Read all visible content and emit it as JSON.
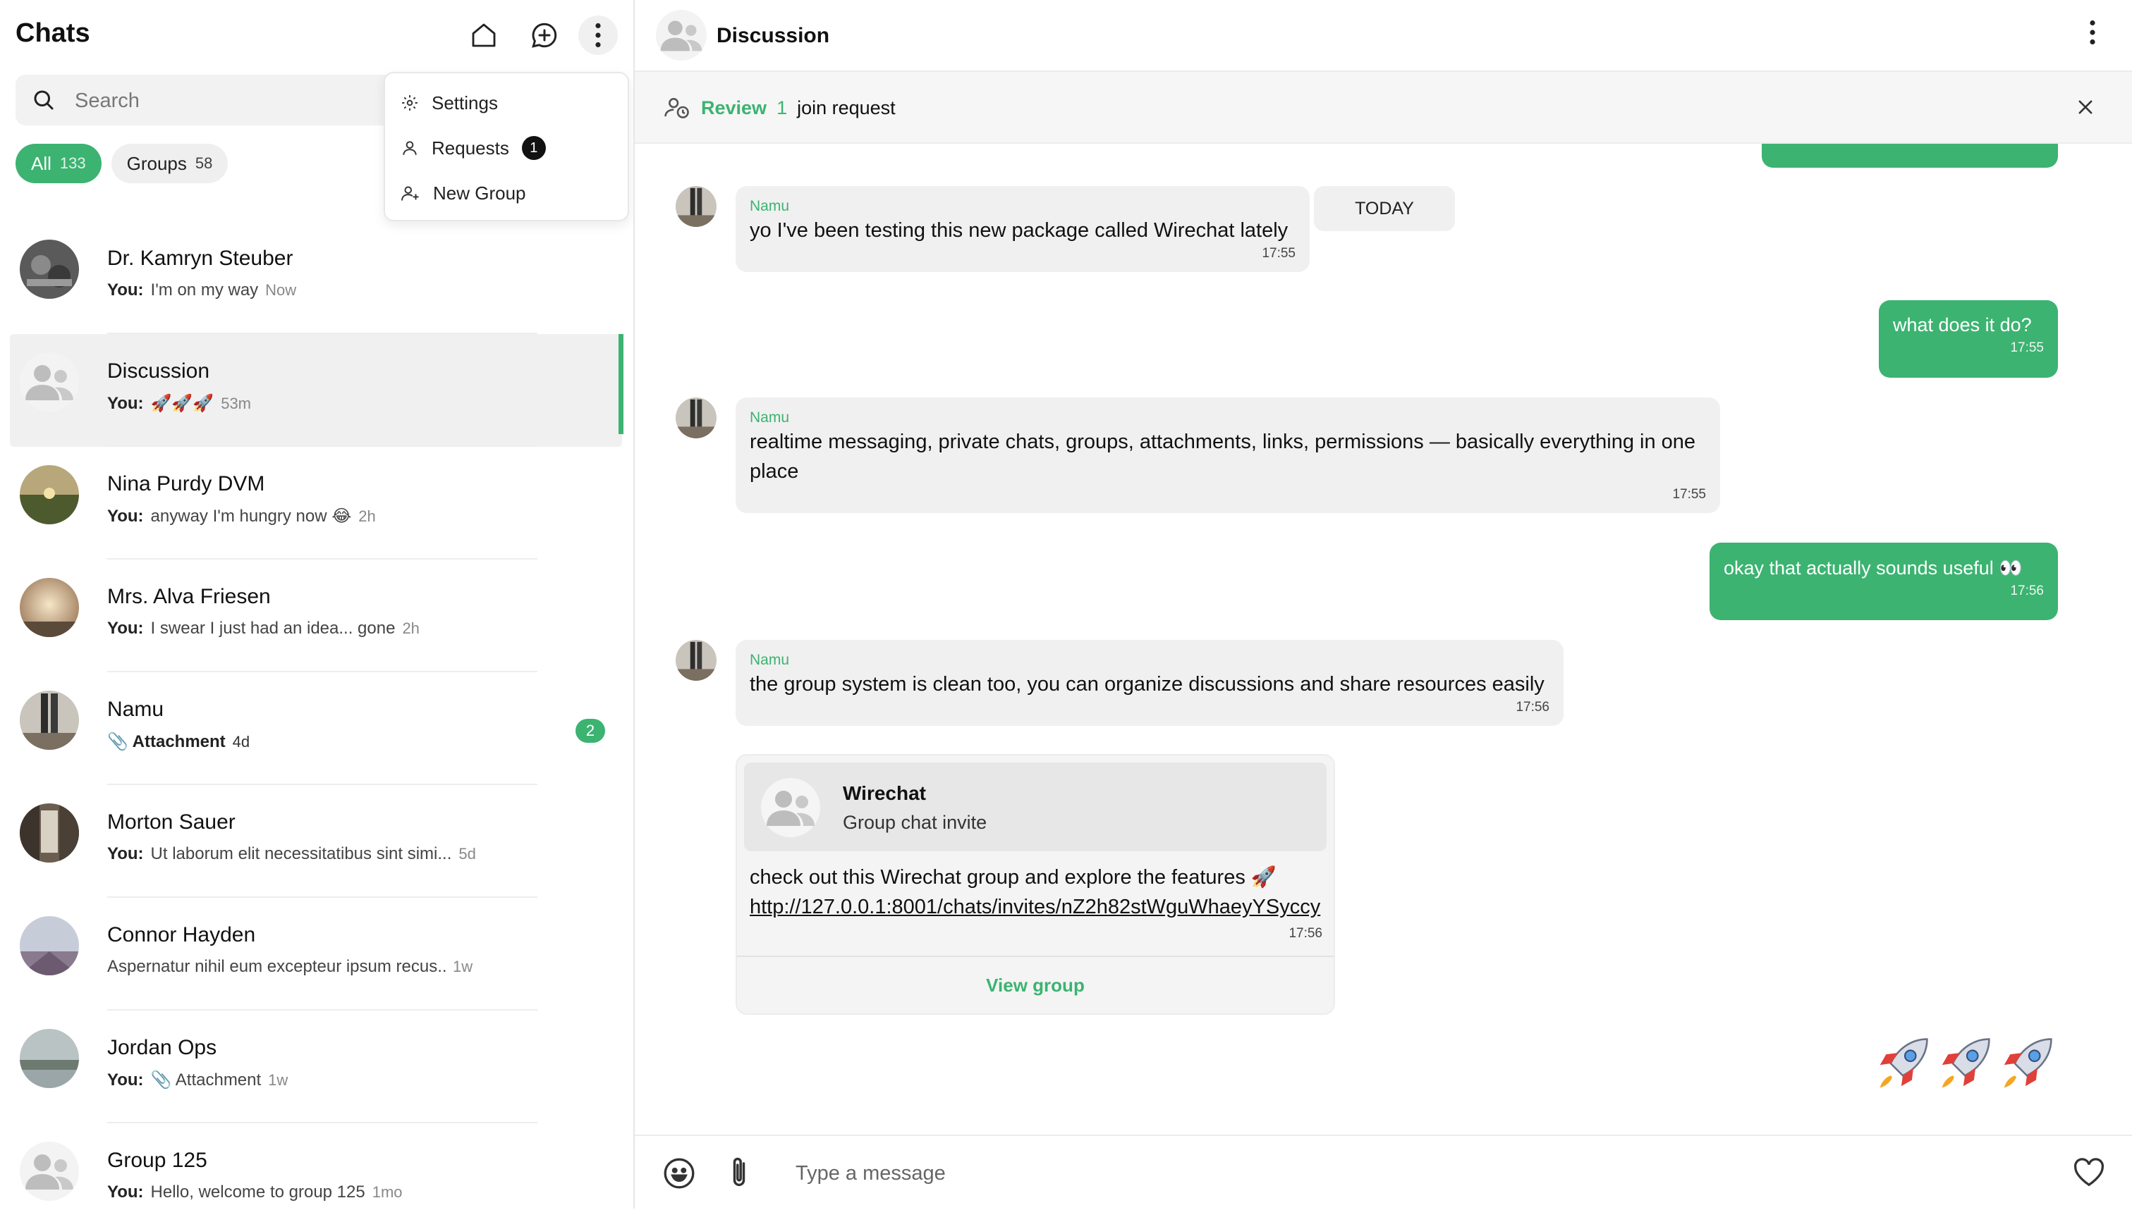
{
  "sidebar": {
    "title": "Chats",
    "search_placeholder": "Search",
    "filters": [
      {
        "label": "All",
        "count": "133"
      },
      {
        "label": "Groups",
        "count": "58"
      }
    ],
    "menu": {
      "items": [
        {
          "label": "Settings",
          "icon": "gear-icon"
        },
        {
          "label": "Requests",
          "icon": "user-icon",
          "badge": "1"
        },
        {
          "label": "New Group",
          "icon": "user-plus-icon"
        }
      ]
    },
    "chats": [
      {
        "name": "Dr. Kamryn Steuber",
        "you": "You:",
        "preview": "I'm on my way",
        "time": "Now",
        "unread": ""
      },
      {
        "name": "Discussion",
        "you": "You:",
        "preview": "🚀🚀🚀",
        "time": "53m",
        "unread": ""
      },
      {
        "name": "Nina Purdy DVM",
        "you": "You:",
        "preview": "anyway I'm hungry now 😂",
        "time": "2h",
        "unread": ""
      },
      {
        "name": "Mrs. Alva Friesen",
        "you": "You:",
        "preview": "I swear I just had an idea... gone",
        "time": "2h",
        "unread": ""
      },
      {
        "name": "Namu",
        "you": "",
        "preview": "📎 Attachment",
        "time": "4d",
        "unread": "2"
      },
      {
        "name": "Morton Sauer",
        "you": "You:",
        "preview": "Ut laborum elit necessitatibus sint simi...",
        "time": "5d",
        "unread": ""
      },
      {
        "name": "Connor Hayden",
        "you": "",
        "preview": "Aspernatur nihil eum excepteur ipsum recus...",
        "time": "1w",
        "unread": ""
      },
      {
        "name": "Jordan Ops",
        "you": "You:",
        "preview": "📎 Attachment",
        "time": "1w",
        "unread": ""
      },
      {
        "name": "Group 125",
        "you": "You:",
        "preview": "Hello, welcome to group 125",
        "time": "1mo",
        "unread": ""
      }
    ]
  },
  "conversation": {
    "title": "Discussion",
    "review": {
      "link": "Review",
      "count": "1",
      "text": "join request"
    },
    "date_divider": "TODAY",
    "messages": [
      {
        "sender": "Namu",
        "text": "yo I've been testing this new package called Wirechat lately",
        "time": "17:55"
      },
      {
        "text": "what does it do?",
        "time": "17:55"
      },
      {
        "sender": "Namu",
        "text": "realtime messaging, private chats, groups, attachments, links, permissions — basically everything in one place",
        "time": "17:55"
      },
      {
        "text": "okay that actually sounds useful 👀",
        "time": "17:56"
      },
      {
        "sender": "Namu",
        "text": "the group system is clean too, you can organize discussions and share resources easily",
        "time": "17:56"
      }
    ],
    "invite": {
      "name": "Wirechat",
      "subtitle": "Group chat invite",
      "text": "check out this Wirechat group and explore the features 🚀",
      "link": "http://127.0.0.1:8001/chats/invites/nZ2h82stWguWhaeyYSyccy",
      "time": "17:56",
      "action": "View group"
    },
    "last_message": "🚀🚀🚀",
    "composer_placeholder": "Type a message"
  },
  "colors": {
    "accent": "#3cb371",
    "bubble_in": "#f0f0f0",
    "background": "#ffffff"
  }
}
